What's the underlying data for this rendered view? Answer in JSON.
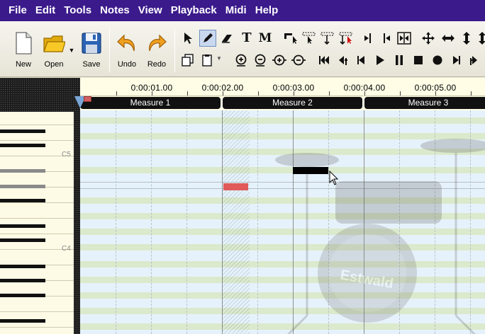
{
  "menu": [
    "File",
    "Edit",
    "Tools",
    "Notes",
    "View",
    "Playback",
    "Midi",
    "Help"
  ],
  "toolbar": {
    "new_label": "New",
    "open_label": "Open",
    "save_label": "Save",
    "undo_label": "Undo",
    "redo_label": "Redo"
  },
  "ruler": {
    "times": [
      "0:00:01.00",
      "0:00:02.00",
      "0:00:03.00",
      "0:00:04.00",
      "0:00:05.00"
    ]
  },
  "measures": [
    "Measure 1",
    "Measure 2",
    "Measure 3"
  ],
  "keyboard": {
    "c5_label": "C5",
    "c4_label": "C4"
  },
  "watermark_text": "Estwald",
  "notes": [
    {
      "measure": 2,
      "state": "selected",
      "color": "#000000"
    },
    {
      "measure": 2,
      "state": "highlighted",
      "color": "#e05a5a"
    }
  ],
  "colors": {
    "menubar": "#3b1a8c",
    "grid_background": "#e6f2fb",
    "row_stripe": "#d9e8c6",
    "ruler_background": "#fffde6"
  }
}
